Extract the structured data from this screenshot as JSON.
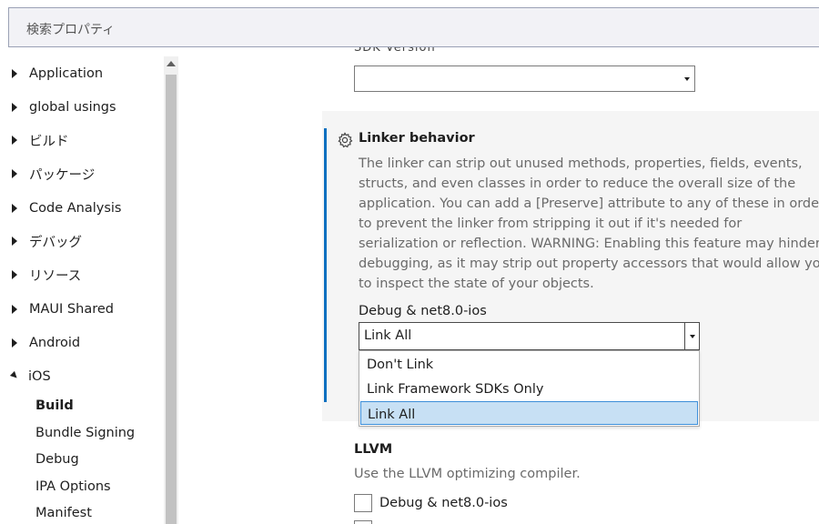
{
  "search": {
    "placeholder": "検索プロパティ"
  },
  "nav": {
    "items": [
      {
        "label": "Application",
        "expanded": false
      },
      {
        "label": "global usings",
        "expanded": false
      },
      {
        "label": "ビルド",
        "expanded": false
      },
      {
        "label": "パッケージ",
        "expanded": false
      },
      {
        "label": "Code Analysis",
        "expanded": false
      },
      {
        "label": "デバッグ",
        "expanded": false
      },
      {
        "label": "リソース",
        "expanded": false
      },
      {
        "label": "MAUI Shared",
        "expanded": false
      },
      {
        "label": "Android",
        "expanded": false
      },
      {
        "label": "iOS",
        "expanded": true
      }
    ],
    "ios_children": [
      {
        "label": "Build",
        "active": true
      },
      {
        "label": "Bundle Signing",
        "active": false
      },
      {
        "label": "Debug",
        "active": false
      },
      {
        "label": "IPA Options",
        "active": false
      },
      {
        "label": "Manifest",
        "active": false
      }
    ]
  },
  "top_field": {
    "value": ""
  },
  "linker": {
    "title": "Linker behavior",
    "description_lines": [
      "The linker can strip out unused methods, properties, fields, events,",
      "structs, and even classes in order to reduce the overall size of the",
      "application. You can add a [Preserve] attribute to any of these in order",
      "to prevent the linker from stripping it out if it's needed for",
      "serialization or reflection. WARNING: Enabling this feature may hinder",
      "debugging, as it may strip out property accessors that would allow you",
      "to inspect the state of your objects."
    ],
    "config_label": "Debug & net8.0-ios",
    "selected_value": "Link All",
    "options": [
      {
        "label": "Don't Link",
        "selected": false
      },
      {
        "label": "Link Framework SDKs Only",
        "selected": false
      },
      {
        "label": "Link All",
        "selected": true
      }
    ]
  },
  "llvm": {
    "title": "LLVM",
    "description": "Use the LLVM optimizing compiler.",
    "checkbox_label": "Debug & net8.0-ios",
    "checked": false
  },
  "colors": {
    "accent": "#0e70c0",
    "selection": "#c7e0f4",
    "panel": "#f5f5f5"
  }
}
